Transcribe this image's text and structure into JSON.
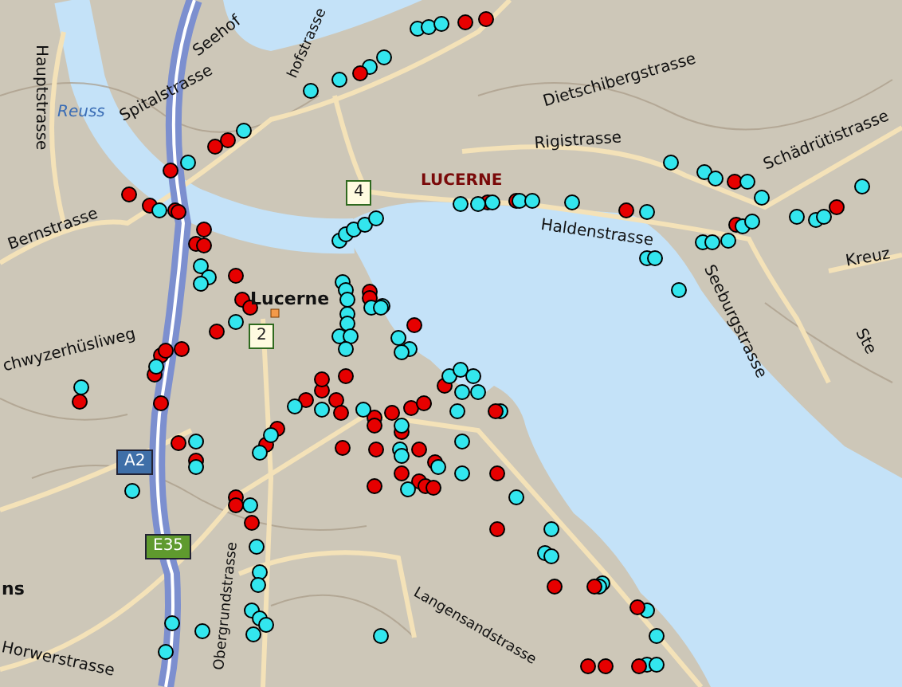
{
  "map": {
    "labels": [
      {
        "text": "Hauptstrasse",
        "kind": "street"
      },
      {
        "text": "Reuss",
        "kind": "water"
      },
      {
        "text": "Seehof",
        "kind": "street"
      },
      {
        "text": "hofstrasse",
        "kind": "street"
      },
      {
        "text": "Spitalstrasse",
        "kind": "street"
      },
      {
        "text": "Dietschibergstrasse",
        "kind": "street"
      },
      {
        "text": "Rigistrasse",
        "kind": "street"
      },
      {
        "text": "LUCERNE",
        "kind": "district"
      },
      {
        "text": "Haldenstrasse",
        "kind": "street"
      },
      {
        "text": "Schädrütistrasse",
        "kind": "street"
      },
      {
        "text": "Seeburgstrasse",
        "kind": "street"
      },
      {
        "text": "Kreuz",
        "kind": "street"
      },
      {
        "text": "Ste",
        "kind": "street"
      },
      {
        "text": "Bernstrasse",
        "kind": "street"
      },
      {
        "text": "Lucerne",
        "kind": "place"
      },
      {
        "text": "chwyzerhüsliweg",
        "kind": "street"
      },
      {
        "text": "Obergrundstrasse",
        "kind": "street"
      },
      {
        "text": "Langensandstrasse",
        "kind": "street"
      },
      {
        "text": "Horwerstrasse",
        "kind": "street"
      },
      {
        "text": "ns",
        "kind": "place"
      }
    ],
    "shields": [
      {
        "text": "4",
        "kind": "route"
      },
      {
        "text": "2",
        "kind": "route"
      },
      {
        "text": "A2",
        "kind": "motorway"
      },
      {
        "text": "E35",
        "kind": "european"
      }
    ],
    "markers": [
      {
        "color": "#33e6ee"
      },
      {
        "color": "#33e6ee"
      },
      {
        "color": "#33e6ee"
      },
      {
        "color": "#33e6ee"
      },
      {
        "color": "#33e6ee"
      },
      {
        "color": "#33e6ee"
      },
      {
        "color": "#33e6ee"
      },
      {
        "color": "#33e6ee"
      },
      {
        "color": "#33e6ee"
      },
      {
        "color": "#e60000"
      },
      {
        "color": "#e60000"
      },
      {
        "color": "#e60000"
      },
      {
        "color": "#e60000"
      },
      {
        "color": "#e60000"
      },
      {
        "color": "#e60000"
      },
      {
        "color": "#e60000"
      },
      {
        "color": "#e60000"
      },
      {
        "color": "#e60000"
      },
      {
        "color": "#e60000"
      },
      {
        "color": "#e60000"
      },
      {
        "color": "#e60000"
      },
      {
        "color": "#e60000"
      },
      {
        "color": "#e60000"
      },
      {
        "color": "#e60000"
      },
      {
        "color": "#e60000"
      },
      {
        "color": "#e60000"
      },
      {
        "color": "#e60000"
      },
      {
        "color": "#33e6ee"
      },
      {
        "color": "#33e6ee"
      },
      {
        "color": "#33e6ee"
      },
      {
        "color": "#33e6ee"
      },
      {
        "color": "#33e6ee"
      },
      {
        "color": "#33e6ee"
      },
      {
        "color": "#33e6ee"
      },
      {
        "color": "#33e6ee"
      },
      {
        "color": "#33e6ee"
      },
      {
        "color": "#33e6ee"
      },
      {
        "color": "#33e6ee"
      },
      {
        "color": "#33e6ee"
      },
      {
        "color": "#33e6ee"
      },
      {
        "color": "#33e6ee"
      },
      {
        "color": "#33e6ee"
      },
      {
        "color": "#33e6ee"
      },
      {
        "color": "#33e6ee"
      },
      {
        "color": "#33e6ee"
      },
      {
        "color": "#33e6ee"
      },
      {
        "color": "#33e6ee"
      },
      {
        "color": "#33e6ee"
      },
      {
        "color": "#e60000"
      },
      {
        "color": "#e60000"
      },
      {
        "color": "#e60000"
      },
      {
        "color": "#e60000"
      },
      {
        "color": "#e60000"
      },
      {
        "color": "#e60000"
      },
      {
        "color": "#e60000"
      },
      {
        "color": "#e60000"
      },
      {
        "color": "#33e6ee"
      },
      {
        "color": "#33e6ee"
      },
      {
        "color": "#33e6ee"
      },
      {
        "color": "#33e6ee"
      },
      {
        "color": "#33e6ee"
      },
      {
        "color": "#33e6ee"
      },
      {
        "color": "#33e6ee"
      },
      {
        "color": "#33e6ee"
      },
      {
        "color": "#33e6ee"
      },
      {
        "color": "#33e6ee"
      },
      {
        "color": "#33e6ee"
      },
      {
        "color": "#33e6ee"
      },
      {
        "color": "#33e6ee"
      },
      {
        "color": "#33e6ee"
      },
      {
        "color": "#33e6ee"
      },
      {
        "color": "#33e6ee"
      },
      {
        "color": "#33e6ee"
      },
      {
        "color": "#33e6ee"
      },
      {
        "color": "#33e6ee"
      },
      {
        "color": "#33e6ee"
      },
      {
        "color": "#33e6ee"
      },
      {
        "color": "#33e6ee"
      },
      {
        "color": "#33e6ee"
      },
      {
        "color": "#33e6ee"
      },
      {
        "color": "#e60000"
      },
      {
        "color": "#e60000"
      },
      {
        "color": "#e60000"
      },
      {
        "color": "#e60000"
      },
      {
        "color": "#e60000"
      },
      {
        "color": "#e60000"
      },
      {
        "color": "#e60000"
      },
      {
        "color": "#e60000"
      },
      {
        "color": "#e60000"
      },
      {
        "color": "#e60000"
      },
      {
        "color": "#e60000"
      },
      {
        "color": "#e60000"
      },
      {
        "color": "#e60000"
      },
      {
        "color": "#e60000"
      },
      {
        "color": "#e60000"
      },
      {
        "color": "#e60000"
      },
      {
        "color": "#e60000"
      },
      {
        "color": "#e60000"
      },
      {
        "color": "#e60000"
      },
      {
        "color": "#e60000"
      },
      {
        "color": "#e60000"
      },
      {
        "color": "#e60000"
      },
      {
        "color": "#e60000"
      },
      {
        "color": "#e60000"
      },
      {
        "color": "#e60000"
      },
      {
        "color": "#e60000"
      },
      {
        "color": "#e60000"
      },
      {
        "color": "#e60000"
      },
      {
        "color": "#e60000"
      },
      {
        "color": "#e60000"
      },
      {
        "color": "#e60000"
      },
      {
        "color": "#e60000"
      },
      {
        "color": "#e60000"
      },
      {
        "color": "#e60000"
      },
      {
        "color": "#e60000"
      },
      {
        "color": "#33e6ee"
      },
      {
        "color": "#33e6ee"
      },
      {
        "color": "#33e6ee"
      },
      {
        "color": "#33e6ee"
      },
      {
        "color": "#33e6ee"
      },
      {
        "color": "#33e6ee"
      },
      {
        "color": "#33e6ee"
      },
      {
        "color": "#33e6ee"
      },
      {
        "color": "#33e6ee"
      },
      {
        "color": "#33e6ee"
      },
      {
        "color": "#33e6ee"
      },
      {
        "color": "#33e6ee"
      },
      {
        "color": "#33e6ee"
      },
      {
        "color": "#33e6ee"
      },
      {
        "color": "#33e6ee"
      },
      {
        "color": "#33e6ee"
      },
      {
        "color": "#33e6ee"
      },
      {
        "color": "#33e6ee"
      },
      {
        "color": "#33e6ee"
      },
      {
        "color": "#33e6ee"
      },
      {
        "color": "#33e6ee"
      },
      {
        "color": "#33e6ee"
      },
      {
        "color": "#33e6ee"
      },
      {
        "color": "#33e6ee"
      },
      {
        "color": "#33e6ee"
      },
      {
        "color": "#33e6ee"
      },
      {
        "color": "#33e6ee"
      },
      {
        "color": "#33e6ee"
      },
      {
        "color": "#33e6ee"
      },
      {
        "color": "#33e6ee"
      },
      {
        "color": "#33e6ee"
      },
      {
        "color": "#33e6ee"
      },
      {
        "color": "#33e6ee"
      },
      {
        "color": "#33e6ee"
      },
      {
        "color": "#33e6ee"
      },
      {
        "color": "#33e6ee"
      },
      {
        "color": "#33e6ee"
      },
      {
        "color": "#33e6ee"
      },
      {
        "color": "#33e6ee"
      },
      {
        "color": "#33e6ee"
      },
      {
        "color": "#33e6ee"
      },
      {
        "color": "#33e6ee"
      },
      {
        "color": "#33e6ee"
      },
      {
        "color": "#33e6ee"
      },
      {
        "color": "#33e6ee"
      },
      {
        "color": "#33e6ee"
      },
      {
        "color": "#33e6ee"
      },
      {
        "color": "#33e6ee"
      },
      {
        "color": "#33e6ee"
      },
      {
        "color": "#e60000"
      },
      {
        "color": "#e60000"
      },
      {
        "color": "#e60000"
      },
      {
        "color": "#e60000"
      },
      {
        "color": "#e60000"
      },
      {
        "color": "#e60000"
      },
      {
        "color": "#e60000"
      },
      {
        "color": "#e60000"
      },
      {
        "color": "#e60000"
      }
    ]
  }
}
